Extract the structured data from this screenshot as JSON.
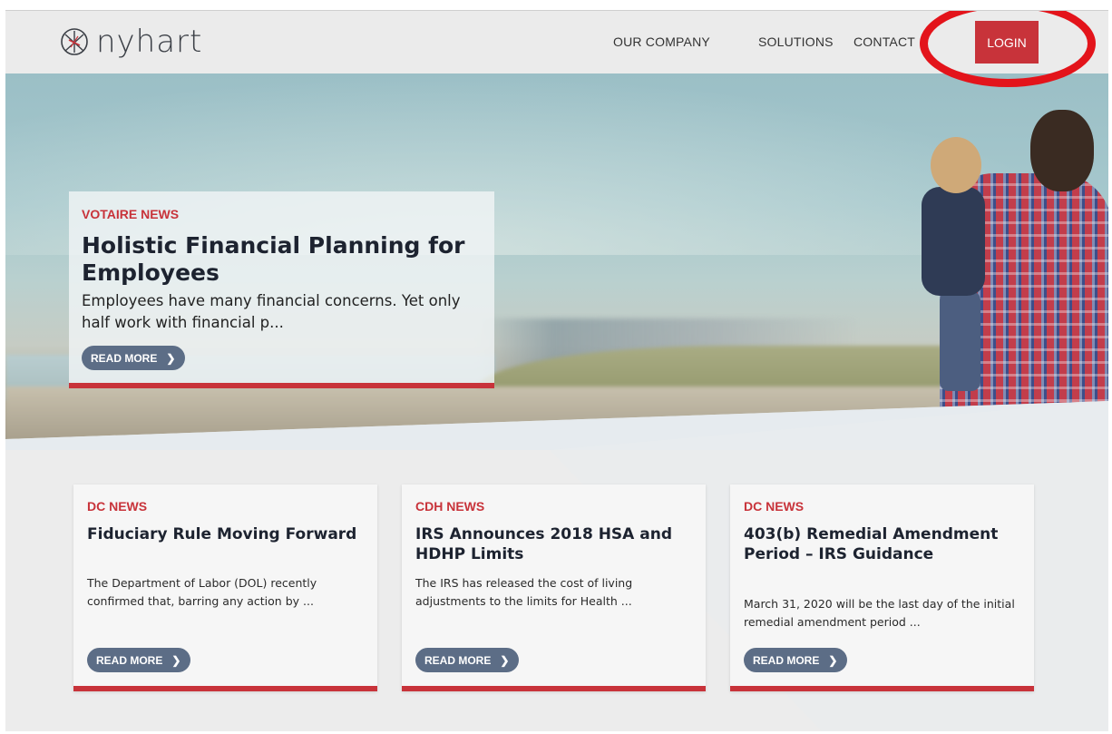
{
  "header": {
    "logo_text": "nyhart",
    "nav": [
      "OUR COMPANY",
      "SOLUTIONS",
      "CONTACT"
    ],
    "login_label": "LOGIN",
    "login_color": "#c8333a",
    "highlight_color": "#e3141b"
  },
  "hero": {
    "tag": "VOTAIRE NEWS",
    "title": "Holistic Financial Planning for Employees",
    "excerpt": "Employees have many financial concerns. Yet only half work with financial p...",
    "read_more": "READ MORE",
    "chevron_icon": "chevron-right-icon"
  },
  "cards": [
    {
      "tag": "DC NEWS",
      "title": "Fiduciary Rule Moving Forward",
      "excerpt": "The Department of Labor (DOL) recently confirmed that, barring any action by ...",
      "read_more": "READ MORE"
    },
    {
      "tag": "CDH NEWS",
      "title": "IRS Announces 2018 HSA and HDHP Limits",
      "excerpt": "The IRS has released the cost of living adjustments to the limits for Health ...",
      "read_more": "READ MORE"
    },
    {
      "tag": "DC NEWS",
      "title": "403(b) Remedial Amendment Period – IRS Guidance",
      "excerpt": "March 31, 2020 will be the last day of the initial remedial amendment period ...",
      "read_more": "READ MORE"
    }
  ],
  "colors": {
    "accent": "#c8333a",
    "button": "#5c6d86",
    "heading": "#1d2330"
  }
}
